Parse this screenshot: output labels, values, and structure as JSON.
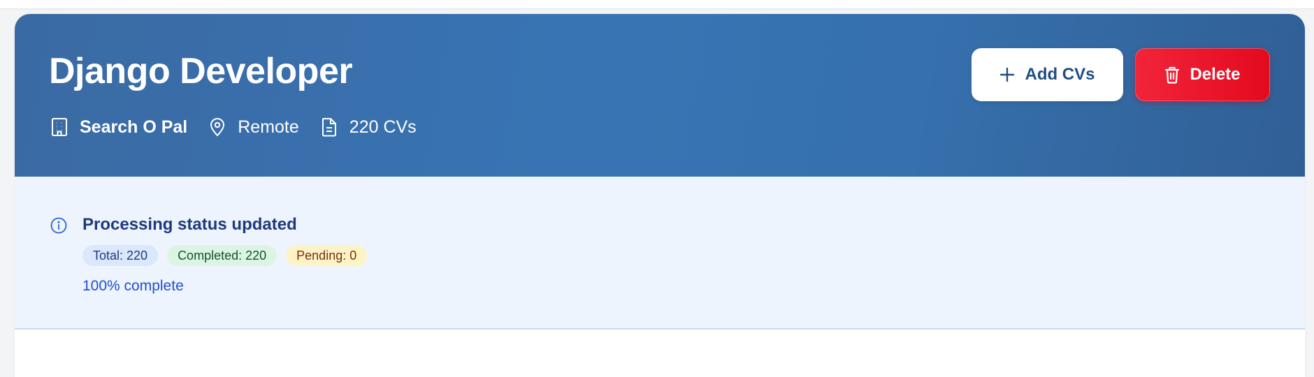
{
  "job": {
    "title": "Django Developer",
    "company": "Search O Pal",
    "location": "Remote",
    "cv_count": "220 CVs"
  },
  "actions": {
    "add_label": "Add CVs",
    "delete_label": "Delete"
  },
  "status": {
    "title": "Processing status updated",
    "badges": {
      "total": "Total: 220",
      "completed": "Completed: 220",
      "pending": "Pending: 0"
    },
    "progress_text": "100% complete"
  },
  "icons": {
    "company": "building-icon",
    "location": "map-pin-icon",
    "cvs": "document-icon",
    "add": "plus-icon",
    "delete": "trash-icon",
    "info": "info-circle-icon"
  },
  "colors": {
    "hero_blue": "#3874b4",
    "delete_red": "#e30a1e",
    "status_bg": "#eef4fd",
    "status_title": "#1e3a7b",
    "progress_link": "#1d4ed8"
  }
}
